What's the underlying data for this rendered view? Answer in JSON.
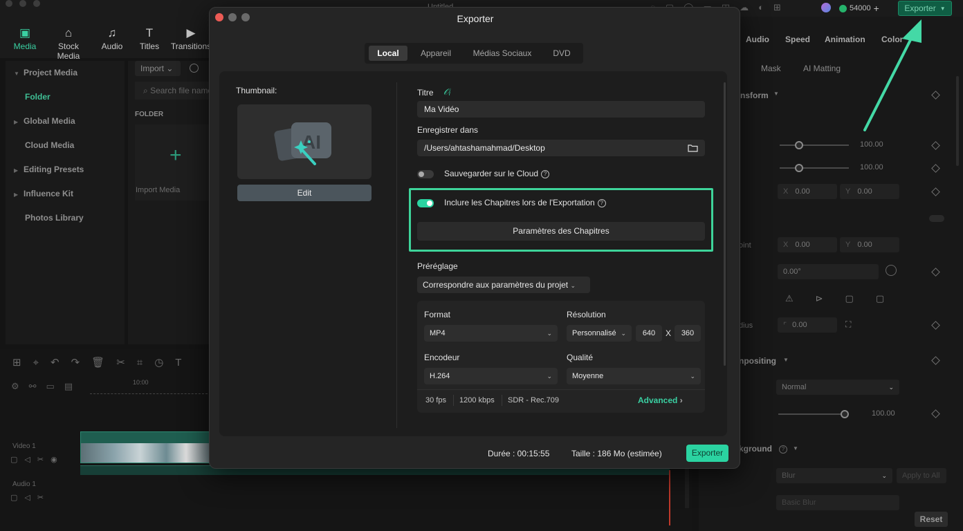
{
  "app": {
    "window_title": "Untitled",
    "credits": "54000",
    "top_export": "Exporter"
  },
  "media_tabs": [
    {
      "label": "Media",
      "icon": "media-icon"
    },
    {
      "label": "Stock Media",
      "icon": "stock-media-icon"
    },
    {
      "label": "Audio",
      "icon": "audio-icon"
    },
    {
      "label": "Titles",
      "icon": "titles-icon"
    },
    {
      "label": "Transitions",
      "icon": "transitions-icon"
    }
  ],
  "left_panel": {
    "items": [
      "Project Media",
      "Global Media",
      "Cloud Media",
      "Editing Presets",
      "Influence Kit",
      "Photos Library"
    ],
    "folder": "Folder",
    "import_btn": "Import",
    "search_placeholder": "Search file name",
    "folder_header": "FOLDER",
    "import_media": "Import Media"
  },
  "right_panel": {
    "tabs": [
      "Audio",
      "Speed",
      "Animation",
      "Color"
    ],
    "subtabs": [
      "Mask",
      "AI Matting"
    ],
    "transform": "nsform",
    "scale_val1": "100.00",
    "scale_val2": "100.00",
    "x_label": "X",
    "y_label": "Y",
    "pos_x": "0.00",
    "pos_y": "0.00",
    "anchor_partial": "oint",
    "anchor_x": "0.00",
    "anchor_y": "0.00",
    "rotate": "0.00°",
    "radius_partial": "dius",
    "radius": "0.00",
    "compositing": "npositing",
    "blend": "Normal",
    "opacity": "100.00",
    "background": "kground",
    "bg_type": "Blur",
    "apply_all": "Apply to All",
    "bg_style": "Basic Blur",
    "reset": "Reset"
  },
  "timeline": {
    "time": "10:00",
    "video_track": "Video 1",
    "audio_track": "Audio 1"
  },
  "dialog": {
    "title": "Exporter",
    "tabs": [
      "Local",
      "Appareil",
      "Médias Sociaux",
      "DVD"
    ],
    "active_tab": "Local",
    "thumbnail_label": "Thumbnail:",
    "edit_btn": "Edit",
    "title_label": "Titre",
    "title_value": "Ma Vidéo",
    "save_label": "Enregistrer dans",
    "save_path": "/Users/ahtashamahmad/Desktop",
    "cloud_label": "Sauvegarder sur le Cloud",
    "cloud_on": false,
    "chapters_label": "Inclure les Chapitres lors de l'Exportation",
    "chapters_on": true,
    "chapters_btn": "Paramètres des Chapitres",
    "preset_label": "Préréglage",
    "preset_value": "Correspondre aux paramètres du projet",
    "format_label": "Format",
    "format_value": "MP4",
    "resolution_label": "Résolution",
    "resolution_mode": "Personnalisé",
    "res_w": "640",
    "res_x": "X",
    "res_h": "360",
    "encoder_label": "Encodeur",
    "encoder_value": "H.264",
    "quality_label": "Qualité",
    "quality_value": "Moyenne",
    "fps": "30 fps",
    "bitrate": "1200 kbps",
    "color": "SDR - Rec.709",
    "advanced": "Advanced",
    "duration": "Durée : 00:15:55",
    "size": "Taille : 186 Mo (estimée)",
    "export_btn": "Exporter"
  },
  "colors": {
    "accent": "#3ad0a2",
    "highlight": "#3ed49a",
    "export_btn": "#2bd3a1"
  }
}
